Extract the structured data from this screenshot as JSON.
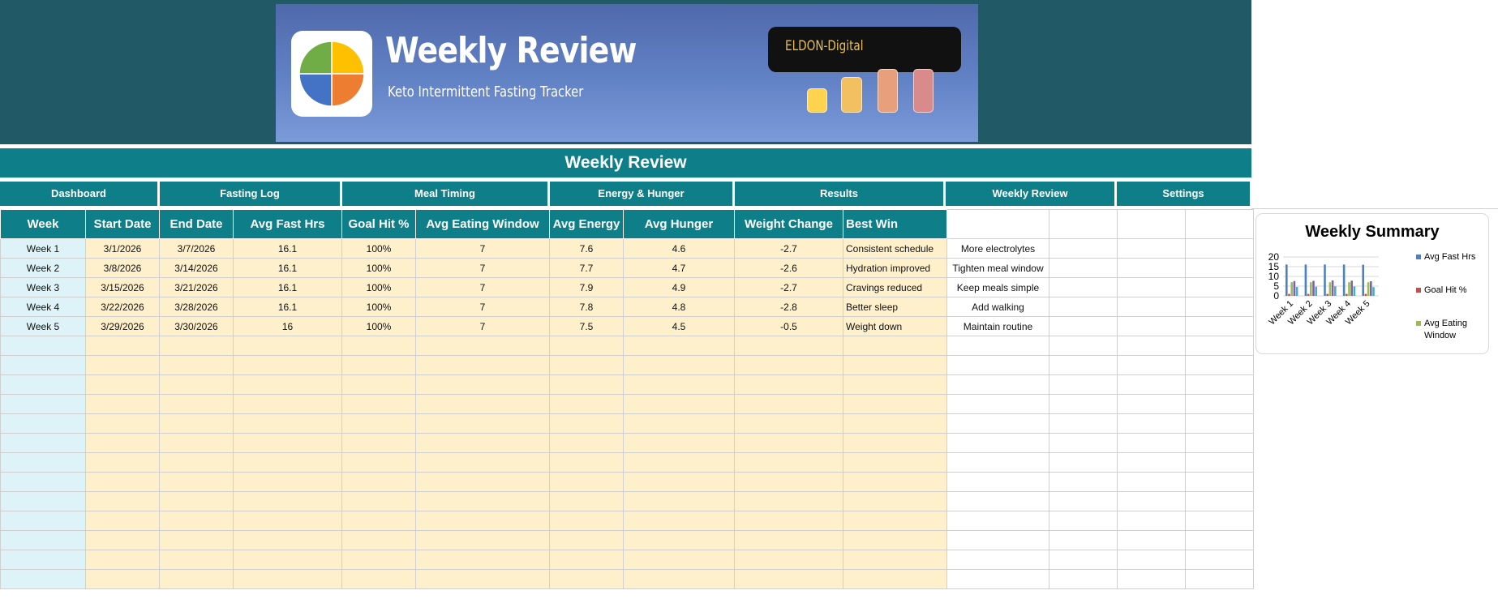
{
  "banner": {
    "title": "Weekly Review",
    "subtitle": "Keto Intermittent Fasting Tracker",
    "brand": "ELDON-Digital"
  },
  "page_title": "Weekly Review",
  "nav": [
    {
      "label": "Dashboard"
    },
    {
      "label": "Fasting Log"
    },
    {
      "label": "Meal Timing"
    },
    {
      "label": "Energy & Hunger"
    },
    {
      "label": "Results"
    },
    {
      "label": "Weekly Review"
    },
    {
      "label": "Settings"
    }
  ],
  "table": {
    "headers": [
      "Week",
      "Start Date",
      "End Date",
      "Avg Fast Hrs",
      "Goal Hit %",
      "Avg Eating Window",
      "Avg Energy",
      "Avg Hunger",
      "Weight Change",
      "Best Win"
    ],
    "rows": [
      {
        "week": "Week 1",
        "start": "3/1/2026",
        "end": "3/7/2026",
        "fast": "16.1",
        "goal": "100%",
        "window": "7",
        "energy": "7.6",
        "hunger": "4.6",
        "weight": "-2.7",
        "win": "Consistent schedule",
        "next": "More electrolytes"
      },
      {
        "week": "Week 2",
        "start": "3/8/2026",
        "end": "3/14/2026",
        "fast": "16.1",
        "goal": "100%",
        "window": "7",
        "energy": "7.7",
        "hunger": "4.7",
        "weight": "-2.6",
        "win": "Hydration improved",
        "next": "Tighten meal window"
      },
      {
        "week": "Week 3",
        "start": "3/15/2026",
        "end": "3/21/2026",
        "fast": "16.1",
        "goal": "100%",
        "window": "7",
        "energy": "7.9",
        "hunger": "4.9",
        "weight": "-2.7",
        "win": "Cravings reduced",
        "next": "Keep meals simple"
      },
      {
        "week": "Week 4",
        "start": "3/22/2026",
        "end": "3/28/2026",
        "fast": "16.1",
        "goal": "100%",
        "window": "7",
        "energy": "7.8",
        "hunger": "4.8",
        "weight": "-2.8",
        "win": "Better sleep",
        "next": "Add walking"
      },
      {
        "week": "Week 5",
        "start": "3/29/2026",
        "end": "3/30/2026",
        "fast": "16",
        "goal": "100%",
        "window": "7",
        "energy": "7.5",
        "hunger": "4.5",
        "weight": "-0.5",
        "win": "Weight down",
        "next": "Maintain routine"
      }
    ]
  },
  "chart_data": {
    "type": "bar",
    "title": "Weekly Summary",
    "categories": [
      "Week 1",
      "Week 2",
      "Week 3",
      "Week 4",
      "Week 5"
    ],
    "series": [
      {
        "name": "Avg Fast Hrs",
        "values": [
          16.1,
          16.1,
          16.1,
          16.1,
          16
        ],
        "color": "#4f81bd"
      },
      {
        "name": "Goal Hit %",
        "values": [
          1,
          1,
          1,
          1,
          1
        ],
        "color": "#c0504d"
      },
      {
        "name": "Avg Eating Window",
        "values": [
          7,
          7,
          7,
          7,
          7
        ],
        "color": "#9bbb59"
      },
      {
        "name": "Avg Energy",
        "values": [
          7.6,
          7.7,
          7.9,
          7.8,
          7.5
        ],
        "color": "#8064a2"
      },
      {
        "name": "Avg Hunger",
        "values": [
          4.6,
          4.7,
          4.9,
          4.8,
          4.5
        ],
        "color": "#4bacc6"
      }
    ],
    "legend_visible": [
      "Avg Fast Hrs",
      "Goal Hit %",
      "Avg Eating Window"
    ],
    "ylim": [
      0,
      20
    ],
    "yticks": [
      "20",
      "15",
      "10",
      "5",
      "0"
    ],
    "legend_position": "right"
  }
}
